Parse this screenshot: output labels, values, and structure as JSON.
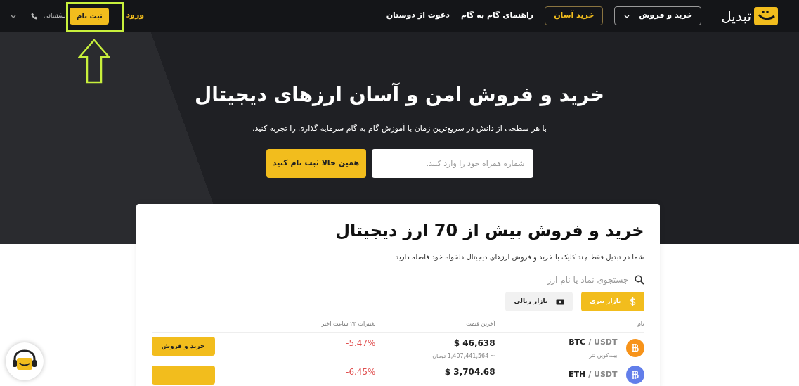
{
  "nav": {
    "logo": "تبدیل",
    "items": [
      {
        "label": "خرید و فروش",
        "kind": "dropdown"
      },
      {
        "label": "خرید آسان",
        "kind": "outlined"
      },
      {
        "label": "راهنمای گام به گام",
        "kind": "link"
      },
      {
        "label": "دعوت از دوستان",
        "kind": "link"
      }
    ],
    "login": "ورود",
    "signup": "ثبت نام",
    "support": "پشتیبانی"
  },
  "hero": {
    "title": "خرید و فروش امن و آسان ارزهای دیجیتال",
    "subtitle": "با هر سطحی از دانش در سریع‌ترین زمان با آموزش گام به گام سرمایه گذاری را تجربه کنید.",
    "phone": {
      "placeholder": "شماره همراه خود را وارد کنید."
    },
    "cta": "همین حالا ثبت نام کنید"
  },
  "market": {
    "title": "خرید و فروش بیش از 70 ارز دیجیتال",
    "subtitle": "شما در تبدیل فقط چند کلیک با خرید و فروش ارزهای دیجیتال دلخواه خود فاصله دارید",
    "search": {
      "placeholder": "جستجوی نماد یا نام ارز"
    },
    "tabs": [
      {
        "label": "بازار تتری",
        "kind": "dollar",
        "selected": true
      },
      {
        "label": "بازار ریالی",
        "kind": "cash",
        "selected": false
      }
    ],
    "columns": [
      "نام",
      "آخرین قیمت",
      "تغییرات ۲۴ ساعت اخیر"
    ],
    "rows": [
      {
        "symbol": "BTC",
        "quote": "/ USDT",
        "name": "بیت‌کوین تتر",
        "price": "$ 46,638",
        "price_toman": "~ 1,407,441,564 تومان",
        "change": "-5.47%",
        "action": "خرید و فروش",
        "color": "#f7931a"
      },
      {
        "symbol": "ETH",
        "quote": "/ USDT",
        "price": "$ 3,704.68",
        "change": "-6.45%",
        "color": "#627eea"
      }
    ]
  }
}
